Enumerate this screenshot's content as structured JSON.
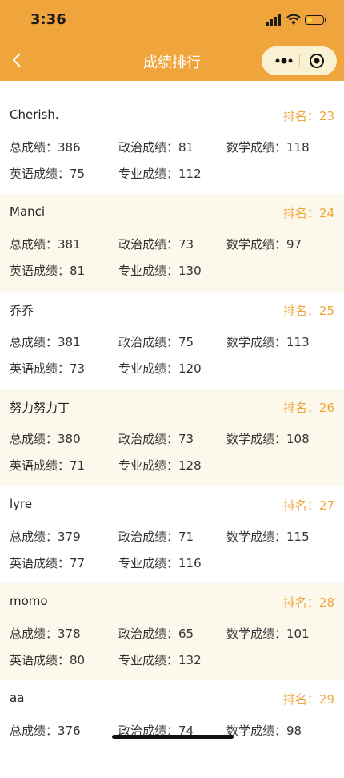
{
  "status": {
    "time": "3:36"
  },
  "nav": {
    "title": "成绩排行"
  },
  "labels": {
    "rank": "排名：",
    "total": "总成绩：",
    "politics": "政治成绩：",
    "math": "数学成绩：",
    "english": "英语成绩：",
    "major": "专业成绩："
  },
  "students": [
    {
      "name": "Cherish.",
      "rank": "23",
      "total": "386",
      "politics": "81",
      "math": "118",
      "english": "75",
      "major": "112"
    },
    {
      "name": "Manci",
      "rank": "24",
      "total": "381",
      "politics": "73",
      "math": "97",
      "english": "81",
      "major": "130"
    },
    {
      "name": "乔乔",
      "rank": "25",
      "total": "381",
      "politics": "75",
      "math": "113",
      "english": "73",
      "major": "120"
    },
    {
      "name": "努力努力丁",
      "rank": "26",
      "total": "380",
      "politics": "73",
      "math": "108",
      "english": "71",
      "major": "128"
    },
    {
      "name": "lyre",
      "rank": "27",
      "total": "379",
      "politics": "71",
      "math": "115",
      "english": "77",
      "major": "116"
    },
    {
      "name": "momo",
      "rank": "28",
      "total": "378",
      "politics": "65",
      "math": "101",
      "english": "80",
      "major": "132"
    },
    {
      "name": "aa",
      "rank": "29",
      "total": "376",
      "politics": "74",
      "math": "98",
      "english": "",
      "major": ""
    }
  ]
}
